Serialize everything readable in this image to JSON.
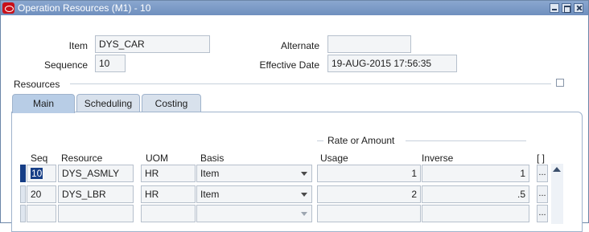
{
  "window": {
    "title": "Operation Resources (M1) - 10"
  },
  "header": {
    "item_label": "Item",
    "item_value": "DYS_CAR",
    "alternate_label": "Alternate",
    "alternate_value": "",
    "sequence_label": "Sequence",
    "sequence_value": "10",
    "effective_date_label": "Effective Date",
    "effective_date_value": "19-AUG-2015 17:56:35"
  },
  "resources": {
    "section_title": "Resources",
    "tabs": [
      {
        "label": "Main",
        "active": true
      },
      {
        "label": "Scheduling",
        "active": false
      },
      {
        "label": "Costing",
        "active": false
      }
    ],
    "group_header": "Rate or Amount",
    "columns": {
      "seq": "Seq",
      "resource": "Resource",
      "uom": "UOM",
      "basis": "Basis",
      "usage": "Usage",
      "inverse": "Inverse",
      "flex": "[ ]"
    },
    "rows": [
      {
        "seq": "10",
        "resource": "DYS_ASMLY",
        "uom": "HR",
        "basis": "Item",
        "usage": "1",
        "inverse": "1",
        "ellipsis": "..."
      },
      {
        "seq": "20",
        "resource": "DYS_LBR",
        "uom": "HR",
        "basis": "Item",
        "usage": "2",
        "inverse": ".5",
        "ellipsis": "..."
      },
      {
        "seq": "",
        "resource": "",
        "uom": "",
        "basis": "",
        "usage": "",
        "inverse": "",
        "ellipsis": "..."
      }
    ]
  },
  "colors": {
    "titlebar": "#7896c4",
    "selection": "#163e86",
    "active_tab": "#b8cde6",
    "inactive_tab": "#d8e1ec"
  }
}
